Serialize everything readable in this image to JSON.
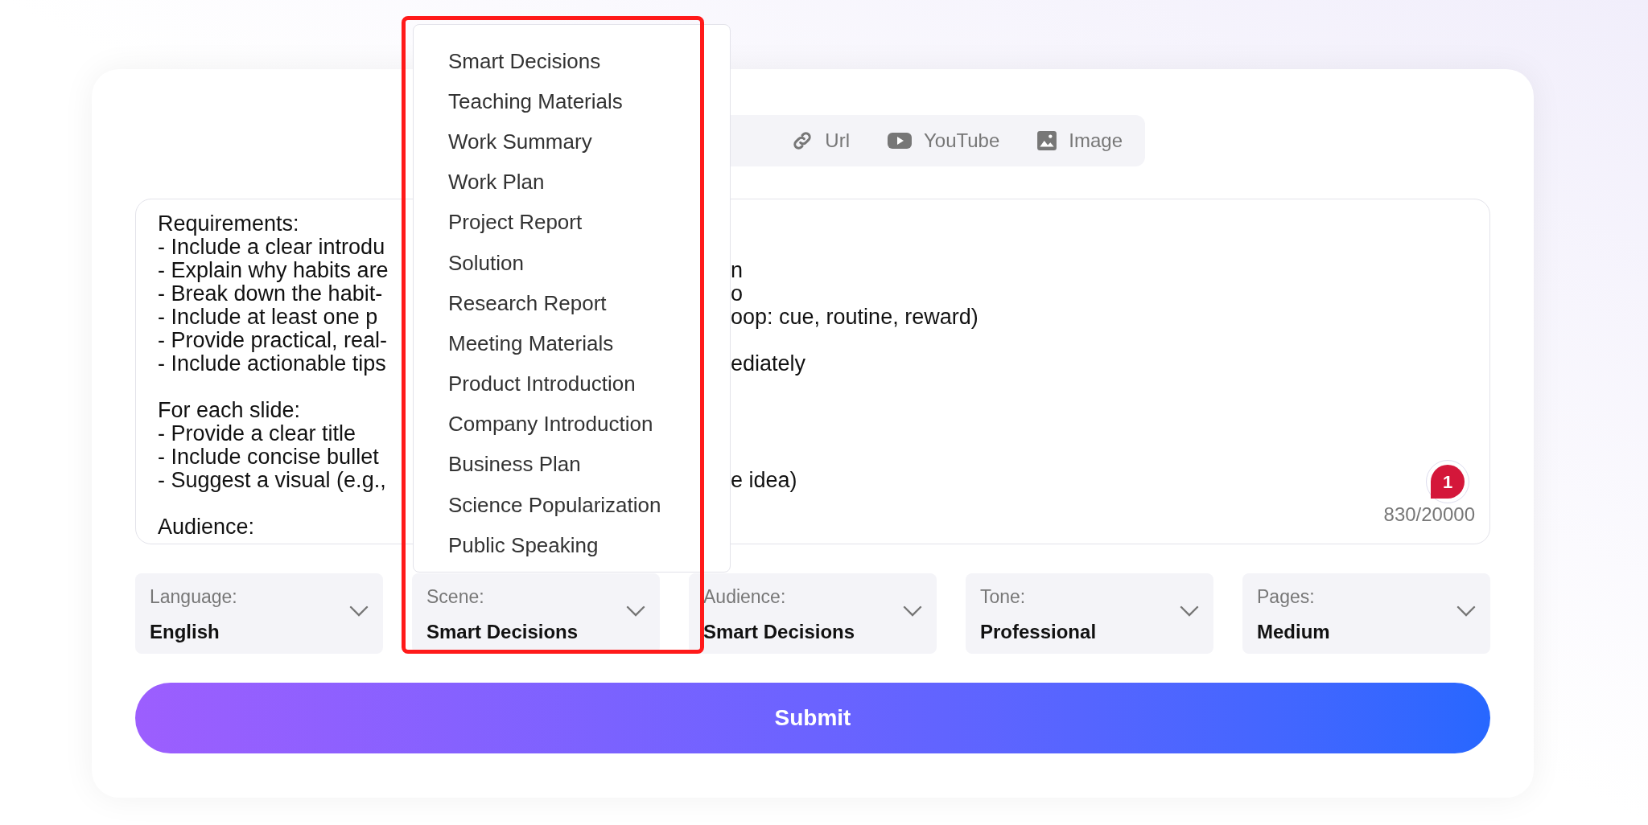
{
  "tabs": [
    {
      "label": "Url",
      "kind": "link",
      "selected": false
    },
    {
      "label": "YouTube",
      "kind": "youtube",
      "selected": false
    },
    {
      "label": "Image",
      "kind": "image",
      "selected": false
    }
  ],
  "prompt": {
    "paragraphs": [
      [
        {
          "start": "Requirements:"
        },
        {
          "start": "- Include a clear introdu"
        },
        {
          "start": "- Explain why habits are",
          "end": "n"
        },
        {
          "start": "- Break down the habit-",
          "end": "o"
        },
        {
          "start": "- Include at least one p",
          "end": "oop: cue, routine, reward)"
        },
        {
          "start": "- Provide practical, real-"
        },
        {
          "start": "- Include actionable tips",
          "end": "ediately"
        }
      ],
      [
        {
          "start": "For each slide:"
        },
        {
          "start": "- Provide a clear title"
        },
        {
          "start": "- Include concise bullet"
        },
        {
          "start": "- Suggest a visual (e.g.,",
          "end": "e idea)"
        }
      ],
      [
        {
          "start": "Audience:"
        }
      ]
    ],
    "counter": "830/20000"
  },
  "notification_badge": {
    "count": "1"
  },
  "scene_dropdown": {
    "items": [
      {
        "label": "Smart Decisions",
        "selected": false
      },
      {
        "label": "Teaching Materials",
        "selected": false
      },
      {
        "label": "Work Summary",
        "selected": false
      },
      {
        "label": "Work Plan",
        "selected": false
      },
      {
        "label": "Project Report",
        "selected": false
      },
      {
        "label": "Solution",
        "selected": false
      },
      {
        "label": "Research Report",
        "selected": false
      },
      {
        "label": "Meeting Materials",
        "selected": false
      },
      {
        "label": "Product Introduction",
        "selected": false
      },
      {
        "label": "Company Introduction",
        "selected": false
      },
      {
        "label": "Business Plan",
        "selected": false
      },
      {
        "label": "Science Popularization",
        "selected": false
      },
      {
        "label": "Public Speaking",
        "selected": false
      }
    ]
  },
  "selects": [
    {
      "label": "Language:",
      "value": "English"
    },
    {
      "label": "Scene:",
      "value": "Smart Decisions"
    },
    {
      "label": "Audience:",
      "value": "Smart Decisions"
    },
    {
      "label": "Tone:",
      "value": "Professional"
    },
    {
      "label": "Pages:",
      "value": "Medium"
    }
  ],
  "submit": "Submit"
}
